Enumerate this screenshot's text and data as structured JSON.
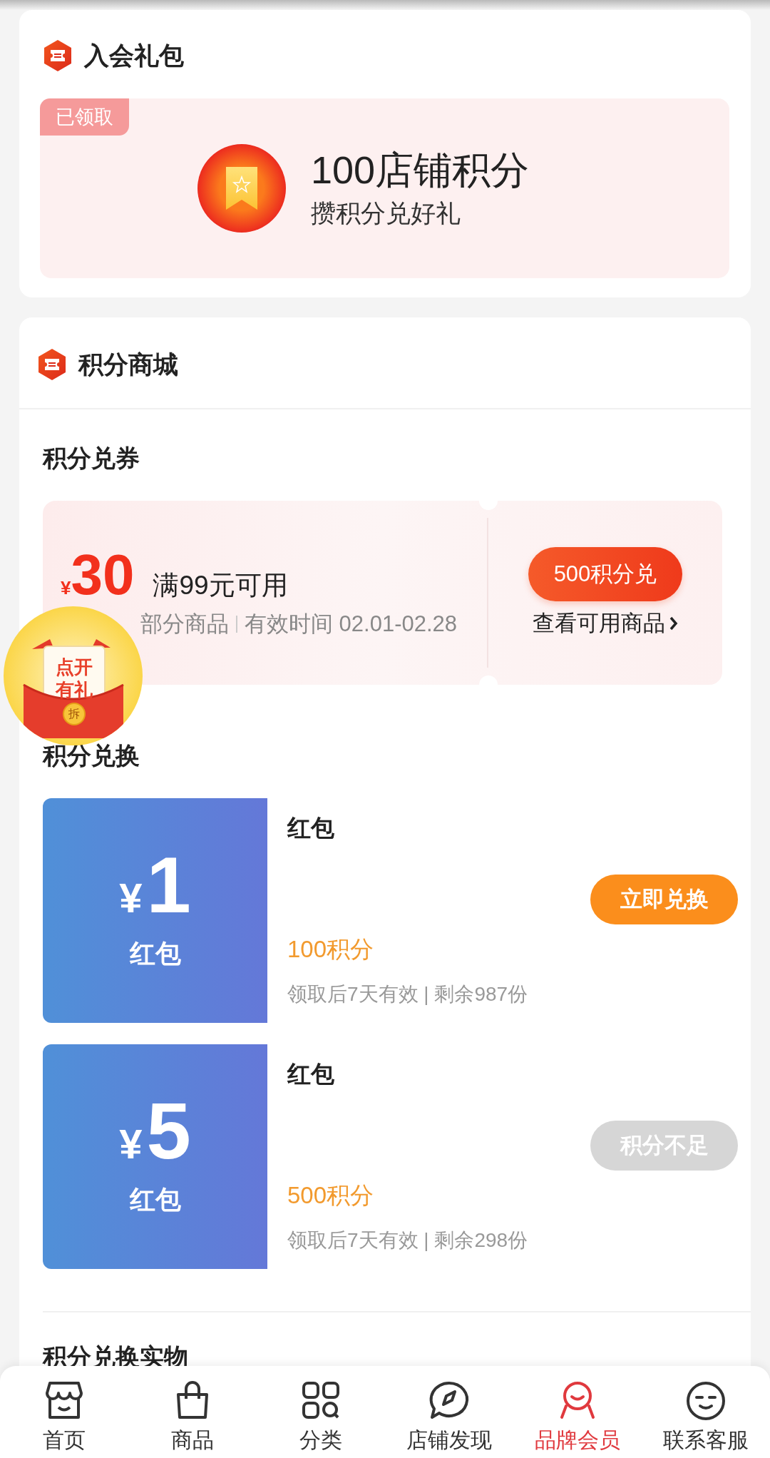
{
  "join_gift": {
    "title": "入会礼包",
    "status_badge": "已领取",
    "reward": "100店铺积分",
    "subtitle": "攒积分兑好礼"
  },
  "points_mall": {
    "title": "积分商城",
    "coupon_section": {
      "title": "积分兑券",
      "coupon": {
        "currency": "¥",
        "amount": "30",
        "condition": "满99元可用",
        "scope": "部分商品",
        "validity": "有效时间 02.01-02.28",
        "button": "500积分兑",
        "link": "查看可用商品"
      }
    },
    "exchange_section": {
      "title": "积分兑换",
      "items": [
        {
          "currency": "¥",
          "amount": "1",
          "tile_label": "红包",
          "name": "红包",
          "points": "100积分",
          "note": "领取后7天有效 | 剩余987份",
          "button": "立即兑换",
          "disabled": false
        },
        {
          "currency": "¥",
          "amount": "5",
          "tile_label": "红包",
          "name": "红包",
          "points": "500积分",
          "note": "领取后7天有效 | 剩余298份",
          "button": "积分不足",
          "disabled": true
        }
      ]
    },
    "goods_section": {
      "title": "积分兑换实物"
    }
  },
  "floating_gift": {
    "line1": "点开",
    "line2": "有礼",
    "seal": "拆"
  },
  "bottom_nav": [
    {
      "label": "首页",
      "selected": false
    },
    {
      "label": "商品",
      "selected": false
    },
    {
      "label": "分类",
      "selected": false
    },
    {
      "label": "店铺发现",
      "selected": false
    },
    {
      "label": "品牌会员",
      "selected": true
    },
    {
      "label": "联系客服",
      "selected": false
    }
  ]
}
